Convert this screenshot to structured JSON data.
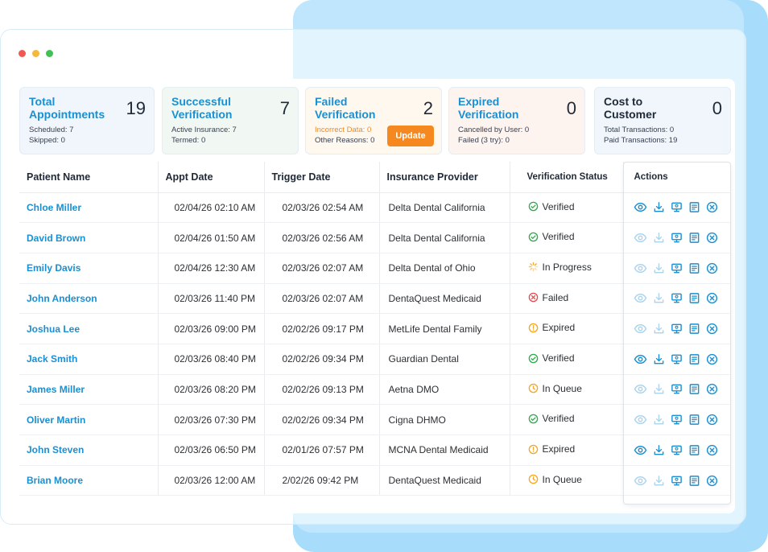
{
  "cards": [
    {
      "title": "Total Appointments",
      "value": "19",
      "subs": [
        "Scheduled: 7",
        "Skipped: 0"
      ],
      "bg": "#f0f6fb",
      "title_color": "#1a8fd1"
    },
    {
      "title": "Successful Verification",
      "value": "7",
      "subs": [
        "Active Insurance: 7",
        "Termed: 0"
      ],
      "bg": "#f1f8f3",
      "title_color": "#1a8fd1"
    },
    {
      "title": "Failed Verification",
      "value": "2",
      "subs": [
        "Incorrect Data: 0",
        "Other Reasons: 0"
      ],
      "bg": "#fff8ef",
      "title_color": "#1a8fd1",
      "button": "Update"
    },
    {
      "title": "Expired Verification",
      "value": "0",
      "subs": [
        "Cancelled by User: 0",
        "Failed (3 try): 0"
      ],
      "bg": "#fdf4f0",
      "title_color": "#1a8fd1"
    },
    {
      "title": "Cost to Customer",
      "value": "0",
      "subs": [
        "Total Transactions: 0",
        "Paid Transactions: 19"
      ],
      "bg": "#f0f6fb",
      "title_color": "#1f2937"
    }
  ],
  "table": {
    "headers": [
      "Patient Name",
      "Appt Date",
      "Trigger Date",
      "Insurance Provider",
      "Verification Status",
      "Actions"
    ],
    "rows": [
      {
        "name": "Chloe Miller",
        "appt": "02/04/26 02:10 AM",
        "trigger": "02/03/26 02:54 AM",
        "provider": "Delta Dental California",
        "status": "Verified",
        "active": true
      },
      {
        "name": "David Brown",
        "appt": "02/04/26 01:50 AM",
        "trigger": "02/03/26 02:56 AM",
        "provider": "Delta Dental California",
        "status": "Verified",
        "active": false
      },
      {
        "name": "Emily Davis",
        "appt": "02/04/26 12:30 AM",
        "trigger": "02/03/26 02:07 AM",
        "provider": "Delta Dental of Ohio",
        "status": "In Progress",
        "active": false
      },
      {
        "name": "John Anderson",
        "appt": "02/03/26 11:40 PM",
        "trigger": "02/03/26 02:07 AM",
        "provider": "DentaQuest Medicaid",
        "status": "Failed",
        "active": false
      },
      {
        "name": "Joshua Lee",
        "appt": "02/03/26 09:00 PM",
        "trigger": "02/02/26 09:17 PM",
        "provider": "MetLife Dental Family",
        "status": "Expired",
        "active": false
      },
      {
        "name": "Jack Smith",
        "appt": "02/03/26 08:40 PM",
        "trigger": "02/02/26 09:34 PM",
        "provider": "Guardian Dental",
        "status": "Verified",
        "active": true
      },
      {
        "name": "James Miller",
        "appt": "02/03/26 08:20 PM",
        "trigger": "02/02/26 09:13 PM",
        "provider": "Aetna DMO",
        "status": "In Queue",
        "active": false
      },
      {
        "name": "Oliver Martin",
        "appt": "02/03/26 07:30 PM",
        "trigger": "02/02/26 09:34 PM",
        "provider": "Cigna DHMO",
        "status": "Verified",
        "active": false
      },
      {
        "name": "John Steven",
        "appt": "02/03/26 06:50 PM",
        "trigger": "02/01/26 07:57 PM",
        "provider": "MCNA Dental Medicaid",
        "status": "Expired",
        "active": true
      },
      {
        "name": "Brian Moore",
        "appt": "02/03/26 12:00 AM",
        "trigger": "2/02/26 09:42 PM",
        "provider": "DentaQuest Medicaid",
        "status": "In Queue",
        "active": false
      }
    ]
  },
  "status_colors": {
    "Verified": "#2eaa4a",
    "In Progress": "#f5a623",
    "Failed": "#e5484d",
    "Expired": "#f5a623",
    "In Queue": "#f5a623"
  },
  "action_icons": [
    "eye-icon",
    "download-icon",
    "monitor-icon",
    "document-icon",
    "close-circle-icon"
  ],
  "colors": {
    "accent": "#1a8fd1",
    "icon_active": "#1a8fd1",
    "icon_inactive": "#a9d4ef",
    "orange": "#f5891f"
  },
  "window_dots": [
    "#ee5a52",
    "#f6b73c",
    "#3fc155"
  ]
}
